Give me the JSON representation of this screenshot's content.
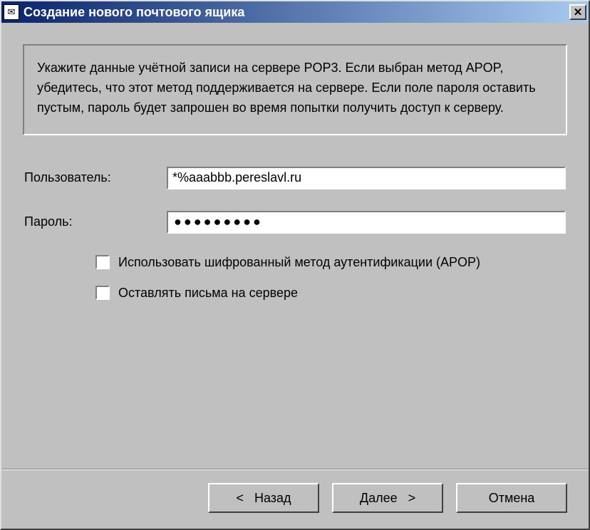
{
  "titlebar": {
    "title": "Создание нового почтового ящика"
  },
  "info": {
    "text": "Укажите данные учётной записи на сервере POP3. Если выбран метод APOP, убедитесь, что этот метод поддерживается на сервере. Если поле пароля оставить пустым, пароль будет запрошен во время попытки получить доступ к серверу."
  },
  "form": {
    "user_label": "Пользователь:",
    "user_value": "*%aaabbb.pereslavl.ru",
    "password_label": "Пароль:",
    "password_mask": "●●●●●●●●●"
  },
  "checks": {
    "apop_label": "Использовать шифрованный метод аутентификации (APOP)",
    "leave_label": "Оставлять письма на сервере"
  },
  "buttons": {
    "back": "<   Назад",
    "next": "Далее   >",
    "cancel": "Отмена"
  }
}
